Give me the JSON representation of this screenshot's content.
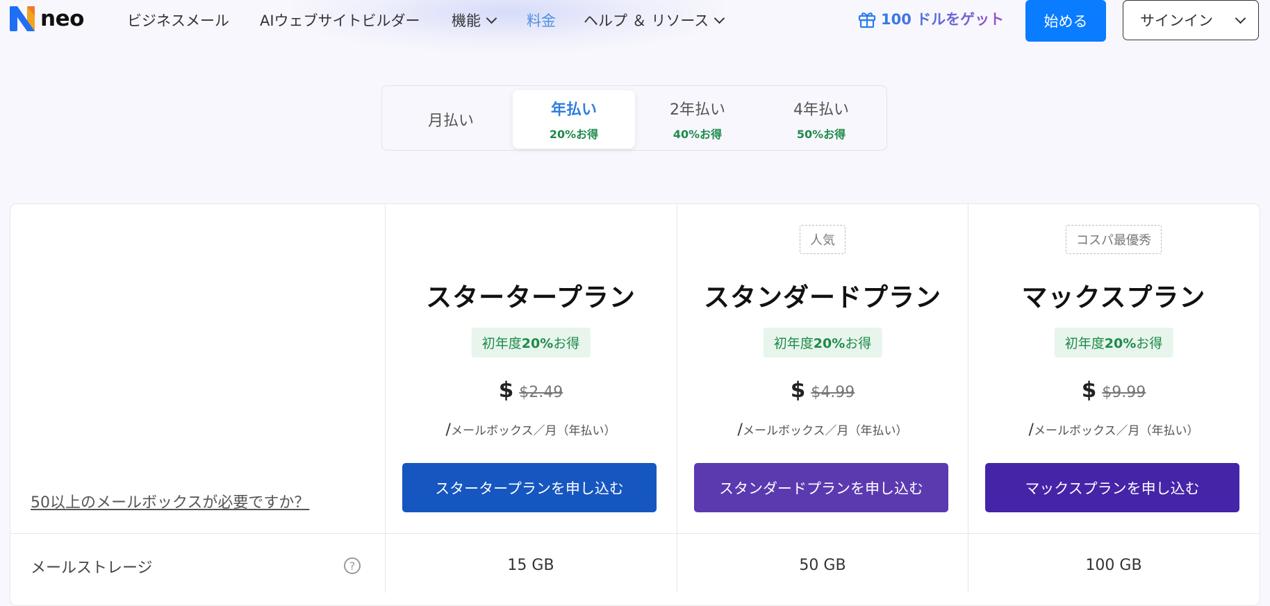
{
  "header": {
    "logo_text": "neo",
    "nav": [
      {
        "label": "ビジネスメール"
      },
      {
        "label": "AIウェブサイトビルダー"
      },
      {
        "label": "機能"
      },
      {
        "label": "料金"
      },
      {
        "label": "ヘルプ ＆ リソース"
      }
    ],
    "promo_label": "100 ドルをゲット",
    "start_label": "始める",
    "signin_label": "サインイン"
  },
  "billing": {
    "options": [
      {
        "label": "月払い",
        "save": ""
      },
      {
        "label": "年払い",
        "save": "20%お得"
      },
      {
        "label": "2年払い",
        "save": "40%お得"
      },
      {
        "label": "4年払い",
        "save": "50%お得"
      }
    ],
    "selected": "年払い"
  },
  "plans": [
    {
      "badge": "",
      "name": "スタータープラン",
      "promo_prefix": "初年度",
      "promo_pct": "20%",
      "promo_suffix": "お得",
      "currency": "$",
      "original_price": "$2.49",
      "per": "メールボックス／月（年払い）",
      "per_slash": "/",
      "cta": "スタータープランを申し込む",
      "cta_color": "#1656c0",
      "storage": "15 GB"
    },
    {
      "badge": "人気",
      "name": "スタンダードプラン",
      "promo_prefix": "初年度",
      "promo_pct": "20%",
      "promo_suffix": "お得",
      "currency": "$",
      "original_price": "$4.99",
      "per": "メールボックス／月（年払い）",
      "per_slash": "/",
      "cta": "スタンダードプランを申し込む",
      "cta_color": "#5b3ab0",
      "storage": "50 GB"
    },
    {
      "badge": "コスパ最優秀",
      "name": "マックスプラン",
      "promo_prefix": "初年度",
      "promo_pct": "20%",
      "promo_suffix": "お得",
      "currency": "$",
      "original_price": "$9.99",
      "per": "メールボックス／月（年払い）",
      "per_slash": "/",
      "cta": "マックスプランを申し込む",
      "cta_color": "#4524a8",
      "storage": "100 GB"
    }
  ],
  "more_mailboxes_link": "50以上のメールボックスが必要ですか？",
  "features": [
    {
      "label": "メールストレージ",
      "help_glyph": "?"
    }
  ],
  "colors": {
    "accent": "#0a7cff",
    "active_nav": "#4f8fe0",
    "save_green": "#1e8a4a"
  },
  "icons": {
    "logo": "neo-logo-icon",
    "gift": "gift-icon",
    "chevron": "chevron-down-icon",
    "help": "help-circle-icon"
  }
}
